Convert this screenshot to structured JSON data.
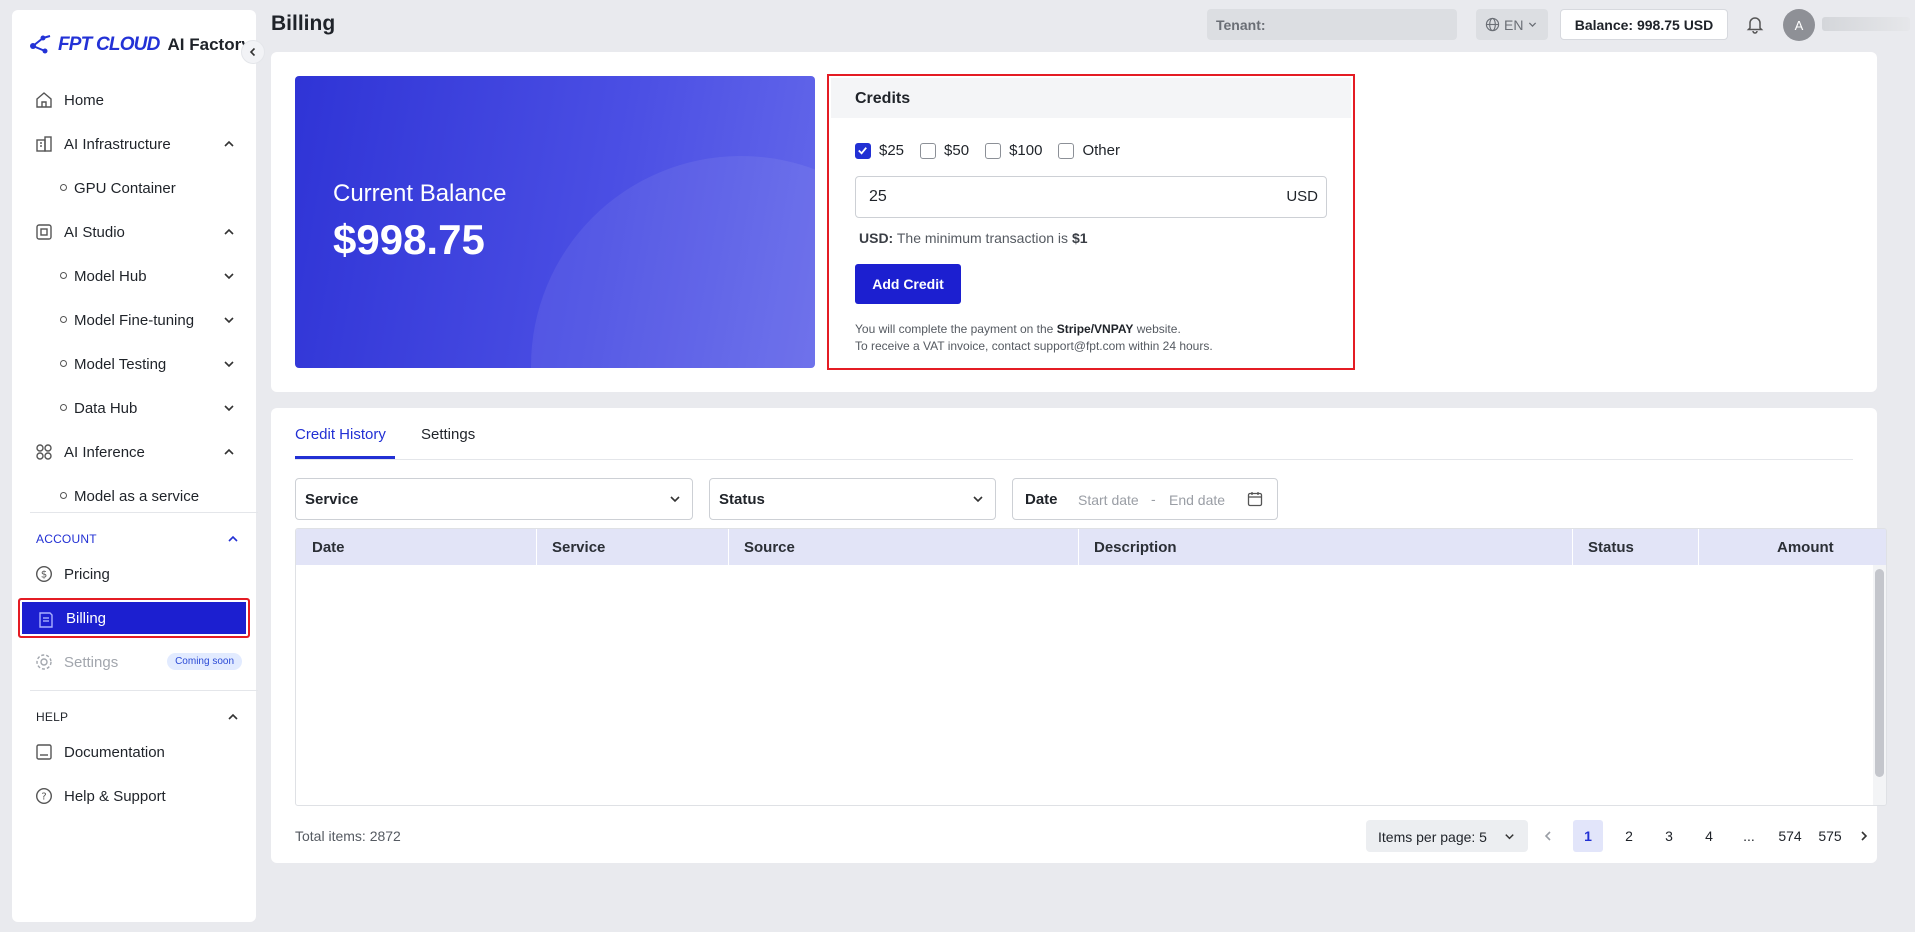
{
  "sidebar": {
    "logo": {
      "brand": "FPT CLOUD",
      "product": "AI Factory"
    },
    "items": [
      {
        "label": "Home"
      },
      {
        "label": "AI Infrastructure"
      },
      {
        "label": "GPU Container"
      },
      {
        "label": "AI Studio"
      },
      {
        "label": "Model Hub"
      },
      {
        "label": "Model Fine-tuning"
      },
      {
        "label": "Model Testing"
      },
      {
        "label": "Data Hub"
      },
      {
        "label": "AI Inference"
      },
      {
        "label": "Model as a service"
      }
    ],
    "account_section": "ACCOUNT",
    "account_items": [
      {
        "label": "Pricing"
      },
      {
        "label": "Billing"
      },
      {
        "label": "Settings",
        "badge": "Coming soon"
      }
    ],
    "help_section": "HELP",
    "help_items": [
      {
        "label": "Documentation"
      },
      {
        "label": "Help & Support"
      }
    ]
  },
  "header": {
    "title": "Billing",
    "tenant_label": "Tenant:",
    "language": "EN",
    "balance": "Balance: 998.75 USD",
    "avatar_initial": "A"
  },
  "balance_card": {
    "label": "Current Balance",
    "amount": "$998.75"
  },
  "credits": {
    "title": "Credits",
    "options": [
      {
        "label": "$25",
        "checked": true
      },
      {
        "label": "$50",
        "checked": false
      },
      {
        "label": "$100",
        "checked": false
      },
      {
        "label": "Other",
        "checked": false
      }
    ],
    "amount_value": "25",
    "amount_unit": "USD",
    "min_prefix": "USD:",
    "min_text": "The minimum transaction is",
    "min_value": "$1",
    "add_button": "Add Credit",
    "note_line1_prefix": "You will complete the payment on the",
    "note_line1_bold": "Stripe/VNPAY",
    "note_line1_suffix": "website.",
    "note_line2": "To receive a VAT invoice, contact support@fpt.com within 24 hours."
  },
  "history": {
    "tabs": [
      {
        "label": "Credit History"
      },
      {
        "label": "Settings"
      }
    ],
    "filters": {
      "service": "Service",
      "status": "Status",
      "date_label": "Date",
      "start_placeholder": "Start date",
      "separator": "-",
      "end_placeholder": "End date"
    },
    "columns": [
      "Date",
      "Service",
      "Source",
      "Description",
      "Status",
      "Amount"
    ],
    "total_items": "Total items: 2872",
    "items_per_page": "Items per page: 5",
    "pages": [
      "1",
      "2",
      "3",
      "4",
      "...",
      "574",
      "575"
    ]
  }
}
